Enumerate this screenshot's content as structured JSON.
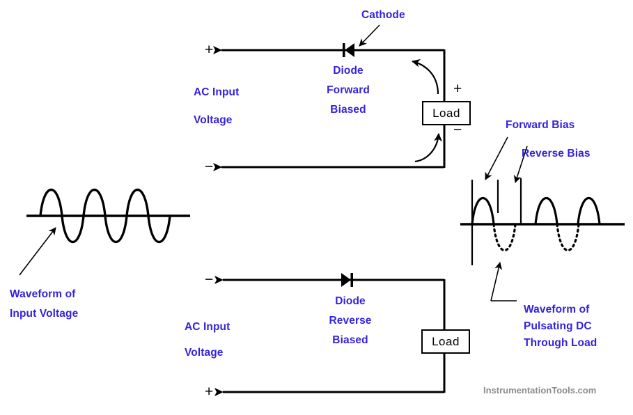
{
  "page": {
    "title": "Half Wave Rectifier Diode Operation Diagram",
    "background": "#ffffff",
    "label_color": "#3322DD",
    "line_color": "#000000",
    "watermark_color": "#8c8c8c"
  },
  "watermark": {
    "text": "InstrumentationTools.com"
  },
  "left_waveform": {
    "caption_line1": "Waveform of",
    "caption_line2": "Input Voltage",
    "type": "full-sine",
    "cycles": 3,
    "baseline_label": "",
    "description": "AC input sine wave, three full cycles, solid line"
  },
  "top_circuit": {
    "source_label_line1": "AC Input",
    "source_label_line2": "Voltage",
    "top_terminal_sign": "+",
    "bottom_terminal_sign": "−",
    "diode_label_line1": "Diode",
    "diode_label_line2": "Forward",
    "diode_label_line3": "Biased",
    "cathode_label": "Cathode",
    "load_label": "Load",
    "load_plus_sign": "+",
    "load_minus_sign": "−",
    "diode_direction": "conducting-left",
    "current_arrows": 2
  },
  "bottom_circuit": {
    "source_label_line1": "AC Input",
    "source_label_line2": "Voltage",
    "top_terminal_sign": "−",
    "bottom_terminal_sign": "+",
    "diode_label_line1": "Diode",
    "diode_label_line2": "Reverse",
    "diode_label_line3": "Biased",
    "load_label": "Load",
    "diode_direction": "blocking-right",
    "current_arrows": 0
  },
  "right_waveform": {
    "caption_line1": "Waveform of",
    "caption_line2": "Pulsating DC",
    "caption_line3": "Through Load",
    "forward_bias_label": "Forward Bias",
    "reverse_bias_label": "Reverse Bias",
    "type": "half-wave-rectified",
    "cycles": 3,
    "positive_half_style": "solid",
    "negative_half_style": "dotted",
    "tick_marks": 3
  },
  "chart_data": {
    "type": "line",
    "title": "Half Wave Rectification Waveforms",
    "plots": [
      {
        "name": "Waveform of Input Voltage",
        "xlabel": "",
        "ylabel": "",
        "series": [
          {
            "name": "AC Input Voltage",
            "style": "solid",
            "function": "sin",
            "amplitude": 1.0,
            "cycles": 3,
            "values": [
              0,
              1,
              0,
              -1,
              0,
              1,
              0,
              -1,
              0,
              1,
              0,
              -1,
              0
            ]
          }
        ]
      },
      {
        "name": "Waveform of Pulsating DC Through Load",
        "xlabel": "",
        "ylabel": "",
        "series": [
          {
            "name": "Forward Bias (conducting)",
            "style": "solid",
            "values": [
              0,
              1,
              0,
              0,
              0,
              1,
              0,
              0,
              0,
              1,
              0,
              0,
              0
            ]
          },
          {
            "name": "Reverse Bias (blocked)",
            "style": "dotted",
            "values": [
              0,
              0,
              0,
              -1,
              0,
              0,
              0,
              -1,
              0,
              0,
              0,
              -1,
              0
            ]
          }
        ],
        "annotations": [
          "Forward Bias",
          "Reverse Bias"
        ]
      }
    ]
  }
}
